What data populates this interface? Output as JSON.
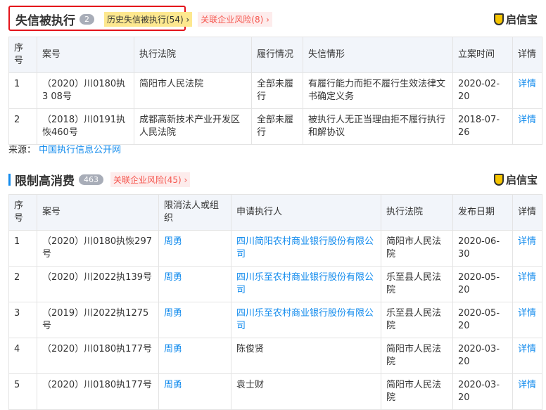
{
  "section1": {
    "title": "失信被执行",
    "count": "2",
    "history_tag": "历史失信被执行(54)",
    "risk_tag": "关联企业风险(8)",
    "brand": "启信宝",
    "headers": [
      "序号",
      "案号",
      "执行法院",
      "履行情况",
      "失信情形",
      "立案时间",
      "详情"
    ],
    "rows": [
      {
        "no": "1",
        "case": "（2020）川0180执3 08号",
        "court": "简阳市人民法院",
        "status": "全部未履行",
        "situation": "有履行能力而拒不履行生效法律文书确定义务",
        "date": "2020-02-20",
        "detail": "详情"
      },
      {
        "no": "2",
        "case": "（2018）川0191执恢460号",
        "court": "成都高新技术产业开发区人民法院",
        "status": "全部未履行",
        "situation": "被执行人无正当理由拒不履行执行和解协议",
        "date": "2018-07-26",
        "detail": "详情"
      }
    ]
  },
  "source": {
    "label": "来源：",
    "link": "中国执行信息公开网"
  },
  "section2": {
    "title": "限制高消费",
    "count": "463",
    "risk_tag": "关联企业风险(45)",
    "brand": "启信宝",
    "headers": [
      "序号",
      "案号",
      "限消法人或组织",
      "申请执行人",
      "执行法院",
      "发布日期",
      "详情"
    ],
    "rows": [
      {
        "no": "1",
        "case": "（2020）川0180执恢297号",
        "person": "周勇",
        "applicant": "四川简阳农村商业银行股份有限公司",
        "applicant_link": true,
        "court": "简阳市人民法院",
        "date": "2020-06-30",
        "detail": "详情"
      },
      {
        "no": "2",
        "case": "（2020）川2022执139号",
        "person": "周勇",
        "applicant": "四川乐至农村商业银行股份有限公司",
        "applicant_link": true,
        "court": "乐至县人民法院",
        "date": "2020-05-20",
        "detail": "详情"
      },
      {
        "no": "3",
        "case": "（2019）川2022执1275号",
        "person": "周勇",
        "applicant": "四川乐至农村商业银行股份有限公司",
        "applicant_link": true,
        "court": "乐至县人民法院",
        "date": "2020-05-20",
        "detail": "详情"
      },
      {
        "no": "4",
        "case": "（2020）川0180执177号",
        "person": "周勇",
        "applicant": "陈俊贤",
        "applicant_link": false,
        "court": "简阳市人民法院",
        "date": "2020-03-20",
        "detail": "详情"
      },
      {
        "no": "5",
        "case": "（2020）川0180执177号",
        "person": "周勇",
        "applicant": "袁士财",
        "applicant_link": false,
        "court": "简阳市人民法院",
        "date": "2020-03-20",
        "detail": "详情"
      }
    ]
  }
}
